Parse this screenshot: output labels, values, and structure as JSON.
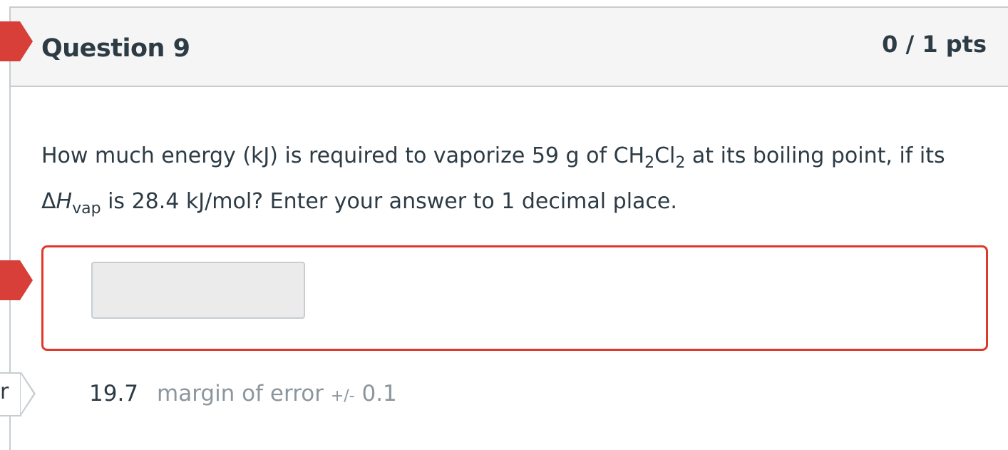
{
  "question": {
    "title": "Question 9",
    "points": "0 / 1 pts",
    "text_part1": "How much energy (kJ) is required to vaporize 59 g of CH",
    "sub1": "2",
    "text_part2": "Cl",
    "sub2": "2",
    "text_part3": " at its boiling point, if its",
    "delta": "Δ",
    "h_italic": "H",
    "sub_vap": "vap",
    "text_part4": " is 28.4 kJ/mol?  Enter your answer to 1 decimal place."
  },
  "answer": {
    "input_value": "",
    "correct_value": "19.7",
    "margin_label": "margin of error",
    "margin_sign": "+/-",
    "margin_value": "0.1"
  },
  "side": {
    "bottom_flag_text": "r"
  },
  "colors": {
    "accent_red": "#d73f38",
    "border_gray": "#c7cdd1",
    "error_red": "#e0392b"
  }
}
